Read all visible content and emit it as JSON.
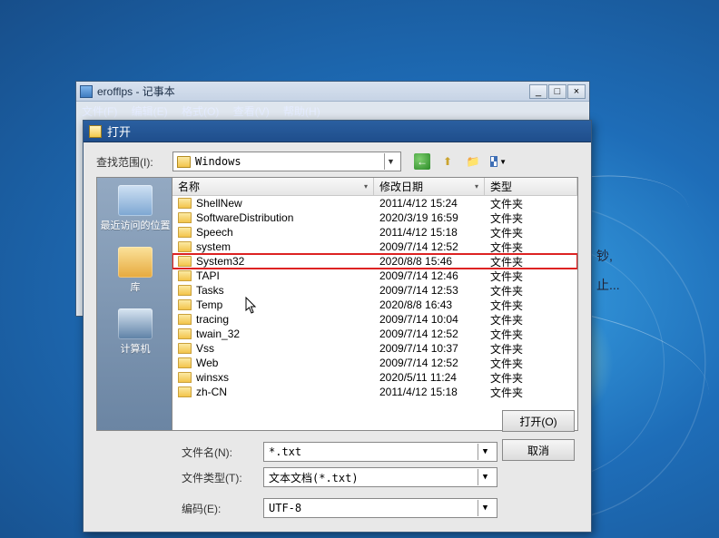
{
  "notepad": {
    "title": "erofflps - 记事本",
    "menu": {
      "file": "文件(F)",
      "edit": "编辑(E)",
      "format": "格式(O)",
      "view": "查看(V)",
      "help": "帮助(H)"
    }
  },
  "dialog": {
    "title": "打开",
    "look_in_label": "查找范围(I):",
    "look_in_value": "Windows",
    "columns": {
      "name": "名称",
      "date": "修改日期",
      "type": "类型"
    },
    "type_folder": "文件夹",
    "filename_label": "文件名(N):",
    "filename_value": "*.txt",
    "filetype_label": "文件类型(T):",
    "filetype_value": "文本文档(*.txt)",
    "encoding_label": "编码(E):",
    "encoding_value": "UTF-8",
    "open_btn": "打开(O)",
    "cancel_btn": "取消"
  },
  "places": {
    "recent": "最近访问的位置",
    "library": "库",
    "computer": "计算机"
  },
  "files": [
    {
      "name": "ShellNew",
      "date": "2011/4/12 15:24"
    },
    {
      "name": "SoftwareDistribution",
      "date": "2020/3/19 16:59"
    },
    {
      "name": "Speech",
      "date": "2011/4/12 15:18"
    },
    {
      "name": "system",
      "date": "2009/7/14 12:52"
    },
    {
      "name": "System32",
      "date": "2020/8/8 15:46",
      "highlight": true
    },
    {
      "name": "TAPI",
      "date": "2009/7/14 12:46"
    },
    {
      "name": "Tasks",
      "date": "2009/7/14 12:53"
    },
    {
      "name": "Temp",
      "date": "2020/8/8 16:43"
    },
    {
      "name": "tracing",
      "date": "2009/7/14 10:04"
    },
    {
      "name": "twain_32",
      "date": "2009/7/14 12:52"
    },
    {
      "name": "Vss",
      "date": "2009/7/14 10:37"
    },
    {
      "name": "Web",
      "date": "2009/7/14 12:52"
    },
    {
      "name": "winsxs",
      "date": "2020/5/11 11:24"
    },
    {
      "name": "zh-CN",
      "date": "2011/4/12 15:18"
    }
  ],
  "bg": {
    "a": "钞,",
    "b": "止..."
  }
}
